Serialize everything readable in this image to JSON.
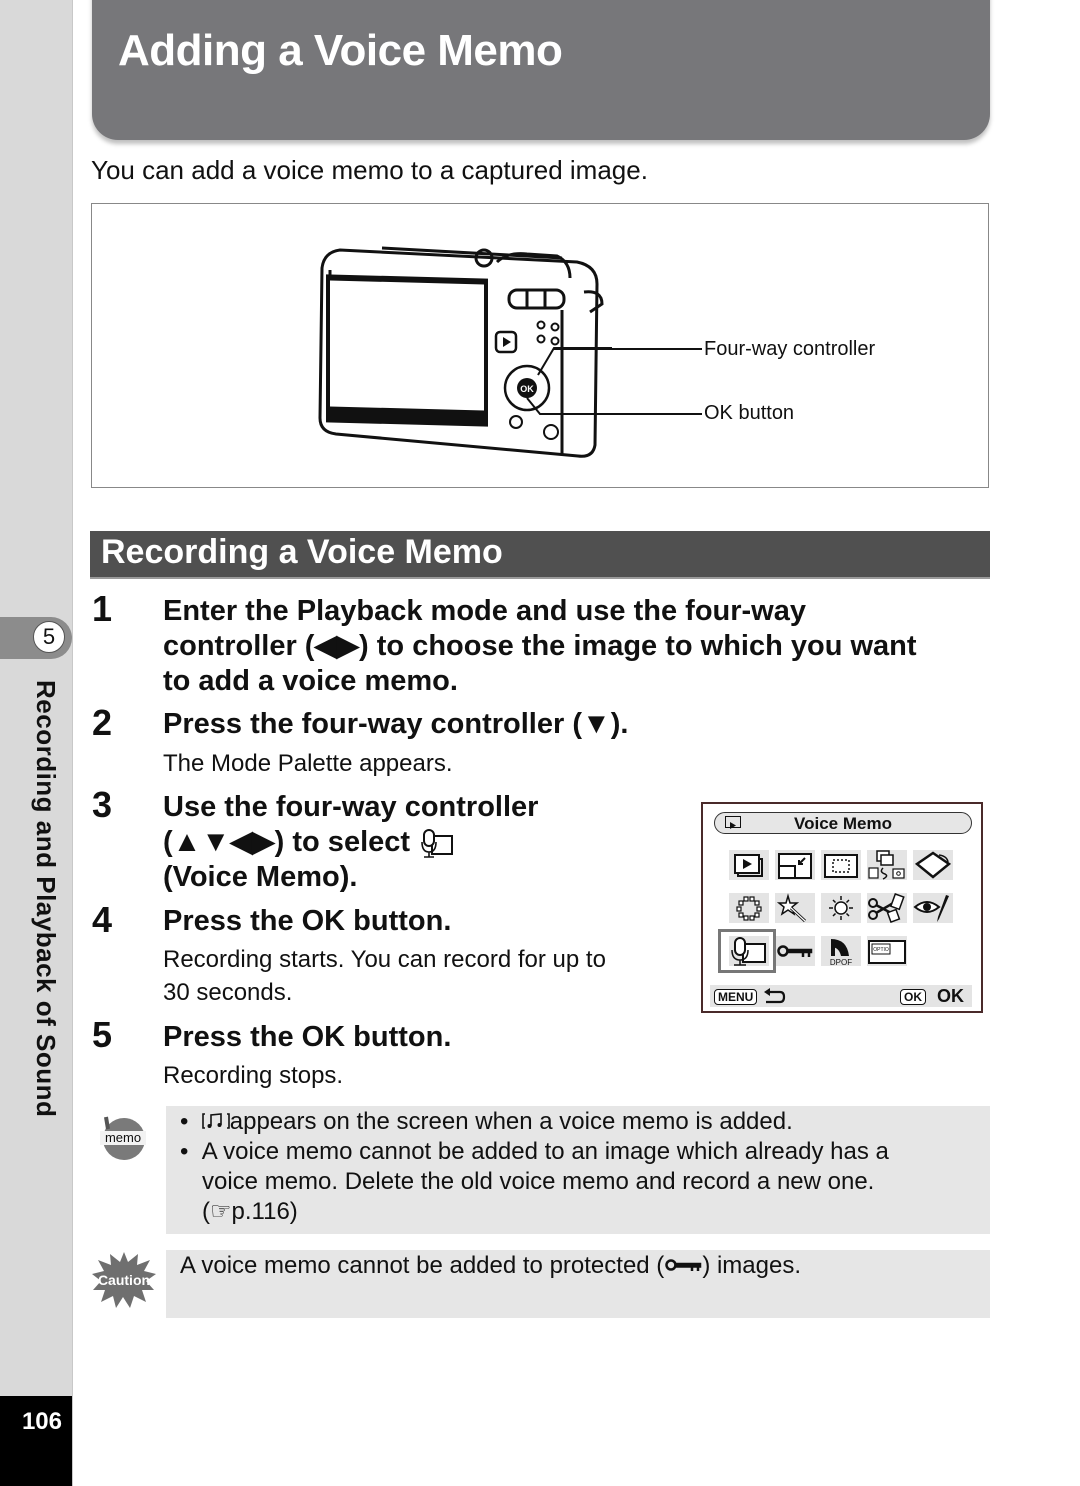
{
  "page": {
    "title": "Adding a Voice Memo",
    "intro": "You can add a voice memo to a captured image.",
    "page_number": "106"
  },
  "sidebar": {
    "chapter_number": "5",
    "chapter_title": "Recording and Playback of Sound"
  },
  "figure": {
    "callouts": [
      {
        "label": "Four-way controller"
      },
      {
        "label": "OK button"
      }
    ]
  },
  "section": {
    "title": "Recording a Voice Memo"
  },
  "steps": [
    {
      "number": "1",
      "heading_lines": [
        "Enter the Playback mode and use the four-way",
        "controller (◀▶) to choose the image to which you want",
        "to add a voice memo."
      ]
    },
    {
      "number": "2",
      "heading": "Press the four-way controller (▼).",
      "body": "The Mode Palette appears."
    },
    {
      "number": "3",
      "heading_lines": [
        "Use the four-way controller",
        "(▲▼◀▶) to select",
        "(Voice Memo)."
      ]
    },
    {
      "number": "4",
      "heading": "Press the OK button.",
      "body_lines": [
        "Recording starts. You can record for up to",
        "30 seconds."
      ]
    },
    {
      "number": "5",
      "heading": "Press the OK button.",
      "body": "Recording stops."
    }
  ],
  "mode_palette": {
    "header_label": "Voice Memo",
    "rows": [
      [
        "playback-icon",
        "resize-icon",
        "cropping-icon",
        "image-copy-icon",
        "rotate-icon"
      ],
      [
        "frame-composite-icon",
        "digital-filter-icon",
        "brightness-icon",
        "movie-edit-icon",
        "red-eye-edit-icon"
      ],
      [
        "voice-memo-icon",
        "protect-icon",
        "dpof-icon",
        "start-up-screen-icon"
      ]
    ],
    "selected": "voice-memo-icon",
    "dpof_label": "DPOF",
    "optio_label": "OPTIO",
    "menu_key": "MENU",
    "ok_key": "OK",
    "ok_label": "OK"
  },
  "memo": {
    "icon_label": "memo",
    "bullets": [
      "appears on the screen when a voice memo is added.",
      "A voice memo cannot be added to an image which already has a",
      "voice memo. Delete the old voice memo and record a new one.",
      "(☞p.116)"
    ]
  },
  "caution": {
    "icon_label": "Caution",
    "text_before": "A voice memo cannot be added to protected (",
    "text_after": ") images."
  }
}
